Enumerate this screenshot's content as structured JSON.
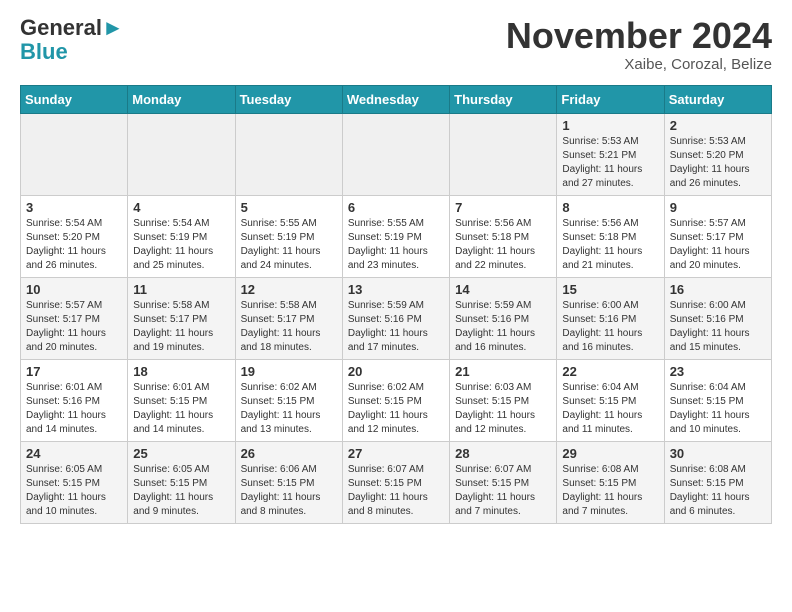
{
  "header": {
    "logo_line1": "General",
    "logo_line2": "Blue",
    "month_title": "November 2024",
    "location": "Xaibe, Corozal, Belize"
  },
  "days_of_week": [
    "Sunday",
    "Monday",
    "Tuesday",
    "Wednesday",
    "Thursday",
    "Friday",
    "Saturday"
  ],
  "weeks": [
    [
      {
        "day": "",
        "info": ""
      },
      {
        "day": "",
        "info": ""
      },
      {
        "day": "",
        "info": ""
      },
      {
        "day": "",
        "info": ""
      },
      {
        "day": "",
        "info": ""
      },
      {
        "day": "1",
        "info": "Sunrise: 5:53 AM\nSunset: 5:21 PM\nDaylight: 11 hours and 27 minutes."
      },
      {
        "day": "2",
        "info": "Sunrise: 5:53 AM\nSunset: 5:20 PM\nDaylight: 11 hours and 26 minutes."
      }
    ],
    [
      {
        "day": "3",
        "info": "Sunrise: 5:54 AM\nSunset: 5:20 PM\nDaylight: 11 hours and 26 minutes."
      },
      {
        "day": "4",
        "info": "Sunrise: 5:54 AM\nSunset: 5:19 PM\nDaylight: 11 hours and 25 minutes."
      },
      {
        "day": "5",
        "info": "Sunrise: 5:55 AM\nSunset: 5:19 PM\nDaylight: 11 hours and 24 minutes."
      },
      {
        "day": "6",
        "info": "Sunrise: 5:55 AM\nSunset: 5:19 PM\nDaylight: 11 hours and 23 minutes."
      },
      {
        "day": "7",
        "info": "Sunrise: 5:56 AM\nSunset: 5:18 PM\nDaylight: 11 hours and 22 minutes."
      },
      {
        "day": "8",
        "info": "Sunrise: 5:56 AM\nSunset: 5:18 PM\nDaylight: 11 hours and 21 minutes."
      },
      {
        "day": "9",
        "info": "Sunrise: 5:57 AM\nSunset: 5:17 PM\nDaylight: 11 hours and 20 minutes."
      }
    ],
    [
      {
        "day": "10",
        "info": "Sunrise: 5:57 AM\nSunset: 5:17 PM\nDaylight: 11 hours and 20 minutes."
      },
      {
        "day": "11",
        "info": "Sunrise: 5:58 AM\nSunset: 5:17 PM\nDaylight: 11 hours and 19 minutes."
      },
      {
        "day": "12",
        "info": "Sunrise: 5:58 AM\nSunset: 5:17 PM\nDaylight: 11 hours and 18 minutes."
      },
      {
        "day": "13",
        "info": "Sunrise: 5:59 AM\nSunset: 5:16 PM\nDaylight: 11 hours and 17 minutes."
      },
      {
        "day": "14",
        "info": "Sunrise: 5:59 AM\nSunset: 5:16 PM\nDaylight: 11 hours and 16 minutes."
      },
      {
        "day": "15",
        "info": "Sunrise: 6:00 AM\nSunset: 5:16 PM\nDaylight: 11 hours and 16 minutes."
      },
      {
        "day": "16",
        "info": "Sunrise: 6:00 AM\nSunset: 5:16 PM\nDaylight: 11 hours and 15 minutes."
      }
    ],
    [
      {
        "day": "17",
        "info": "Sunrise: 6:01 AM\nSunset: 5:16 PM\nDaylight: 11 hours and 14 minutes."
      },
      {
        "day": "18",
        "info": "Sunrise: 6:01 AM\nSunset: 5:15 PM\nDaylight: 11 hours and 14 minutes."
      },
      {
        "day": "19",
        "info": "Sunrise: 6:02 AM\nSunset: 5:15 PM\nDaylight: 11 hours and 13 minutes."
      },
      {
        "day": "20",
        "info": "Sunrise: 6:02 AM\nSunset: 5:15 PM\nDaylight: 11 hours and 12 minutes."
      },
      {
        "day": "21",
        "info": "Sunrise: 6:03 AM\nSunset: 5:15 PM\nDaylight: 11 hours and 12 minutes."
      },
      {
        "day": "22",
        "info": "Sunrise: 6:04 AM\nSunset: 5:15 PM\nDaylight: 11 hours and 11 minutes."
      },
      {
        "day": "23",
        "info": "Sunrise: 6:04 AM\nSunset: 5:15 PM\nDaylight: 11 hours and 10 minutes."
      }
    ],
    [
      {
        "day": "24",
        "info": "Sunrise: 6:05 AM\nSunset: 5:15 PM\nDaylight: 11 hours and 10 minutes."
      },
      {
        "day": "25",
        "info": "Sunrise: 6:05 AM\nSunset: 5:15 PM\nDaylight: 11 hours and 9 minutes."
      },
      {
        "day": "26",
        "info": "Sunrise: 6:06 AM\nSunset: 5:15 PM\nDaylight: 11 hours and 8 minutes."
      },
      {
        "day": "27",
        "info": "Sunrise: 6:07 AM\nSunset: 5:15 PM\nDaylight: 11 hours and 8 minutes."
      },
      {
        "day": "28",
        "info": "Sunrise: 6:07 AM\nSunset: 5:15 PM\nDaylight: 11 hours and 7 minutes."
      },
      {
        "day": "29",
        "info": "Sunrise: 6:08 AM\nSunset: 5:15 PM\nDaylight: 11 hours and 7 minutes."
      },
      {
        "day": "30",
        "info": "Sunrise: 6:08 AM\nSunset: 5:15 PM\nDaylight: 11 hours and 6 minutes."
      }
    ]
  ]
}
